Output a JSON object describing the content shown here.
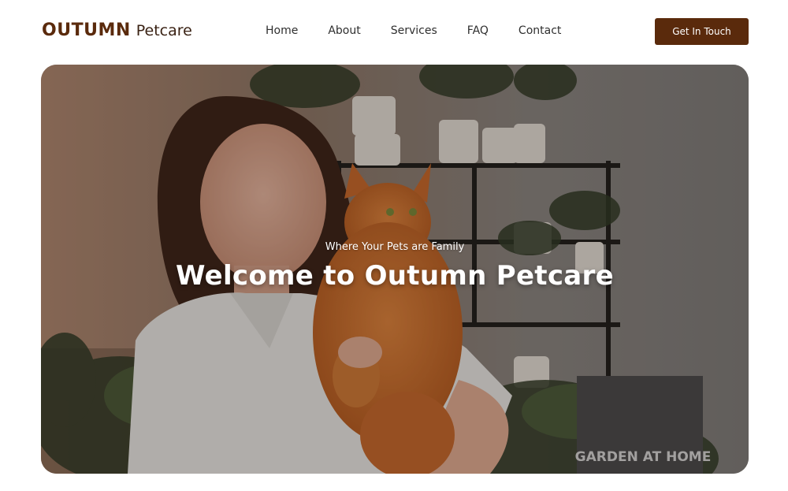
{
  "brand": {
    "name_bold": "OUTUMN",
    "name_light": "Petcare"
  },
  "nav": {
    "items": [
      {
        "label": "Home"
      },
      {
        "label": "About"
      },
      {
        "label": "Services"
      },
      {
        "label": "FAQ"
      },
      {
        "label": "Contact"
      }
    ],
    "cta_label": "Get In Touch"
  },
  "hero": {
    "tagline": "Where Your Pets are Family",
    "title": "Welcome to Outumn Petcare",
    "box_sign_text": "GARDEN AT HOME"
  },
  "colors": {
    "brand_brown": "#5a2a0c",
    "text_dark": "#2f2f2f",
    "hero_text": "#ffffff"
  }
}
